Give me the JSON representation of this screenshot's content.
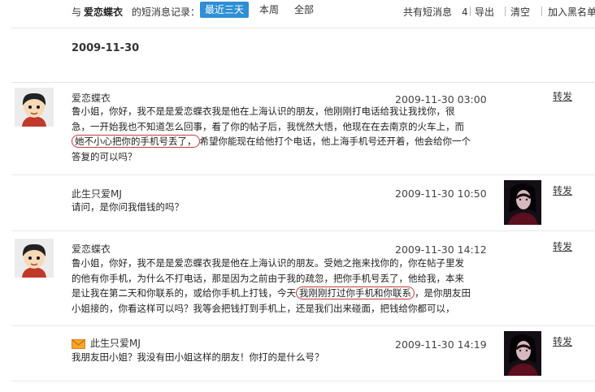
{
  "toolbar": {
    "prefix": "与",
    "peer_name": "爱恋蝶衣",
    "suffix": "的短消息记录：",
    "filters": [
      "最近三天",
      "本周",
      "全部"
    ],
    "active_filter": "最近三天",
    "total": "共有短消息　4",
    "export": "导出",
    "clear": "清空",
    "blacklist": "加入黑名单"
  },
  "date_heading": "2009-11-30",
  "forward_label": "转发",
  "messages": [
    {
      "sender": "爱恋蝶衣",
      "time": "2009-11-30 03:00",
      "line1": "鲁小姐，你好，我不是是爱恋蝶衣我是他在上海认识的朋友，他刚刚打电话给我让我找你，很",
      "line2": "急，一开始我也不知道怎么回事，看了你的帖子后，我恍然大悟，他现在在去南京的火车上，而",
      "circled": "她不小心把你的手机号丢了，",
      "line3_after": "希望你能现在给他打个电话，他上海手机号还开着，他会给你一个",
      "line4": "答复的可以吗？"
    },
    {
      "sender": "此生只爱MJ",
      "time": "2009-11-30 10:50",
      "line1": "请问，是你问我借钱的吗？"
    },
    {
      "sender": "爱恋蝶衣",
      "time": "2009-11-30 14:12",
      "line1": "鲁小姐，你好，我不是是爱恋蝶衣我是他在上海认识的朋友。受她之拖来找你的，你在帖子里发",
      "line2": "的他有你手机，为什么不打电话，那是因为之前由于我的疏忽，把你手机号丢了，他给我，本来",
      "line3_before": "是让我在第二天和你联系的，或给你手机上打钱，今天",
      "circled": "我刚刚打过你手机和你联系",
      "line3_after": "，是你朋友田",
      "line4": "小姐接的，你看这样可以吗？我等会把钱打到手机上，还是我们出来碰面，把钱给你都可以，"
    },
    {
      "sender": "此生只爱MJ",
      "time": "2009-11-30 14:19",
      "line1": "我朋友田小姐？我没有田小姐这样的朋友！你打的是什么号？"
    }
  ],
  "icons": {
    "cartoon_avatar": "boy-avatar-icon",
    "photo_avatar": "mj-photo-avatar",
    "envelope": "envelope-icon"
  }
}
